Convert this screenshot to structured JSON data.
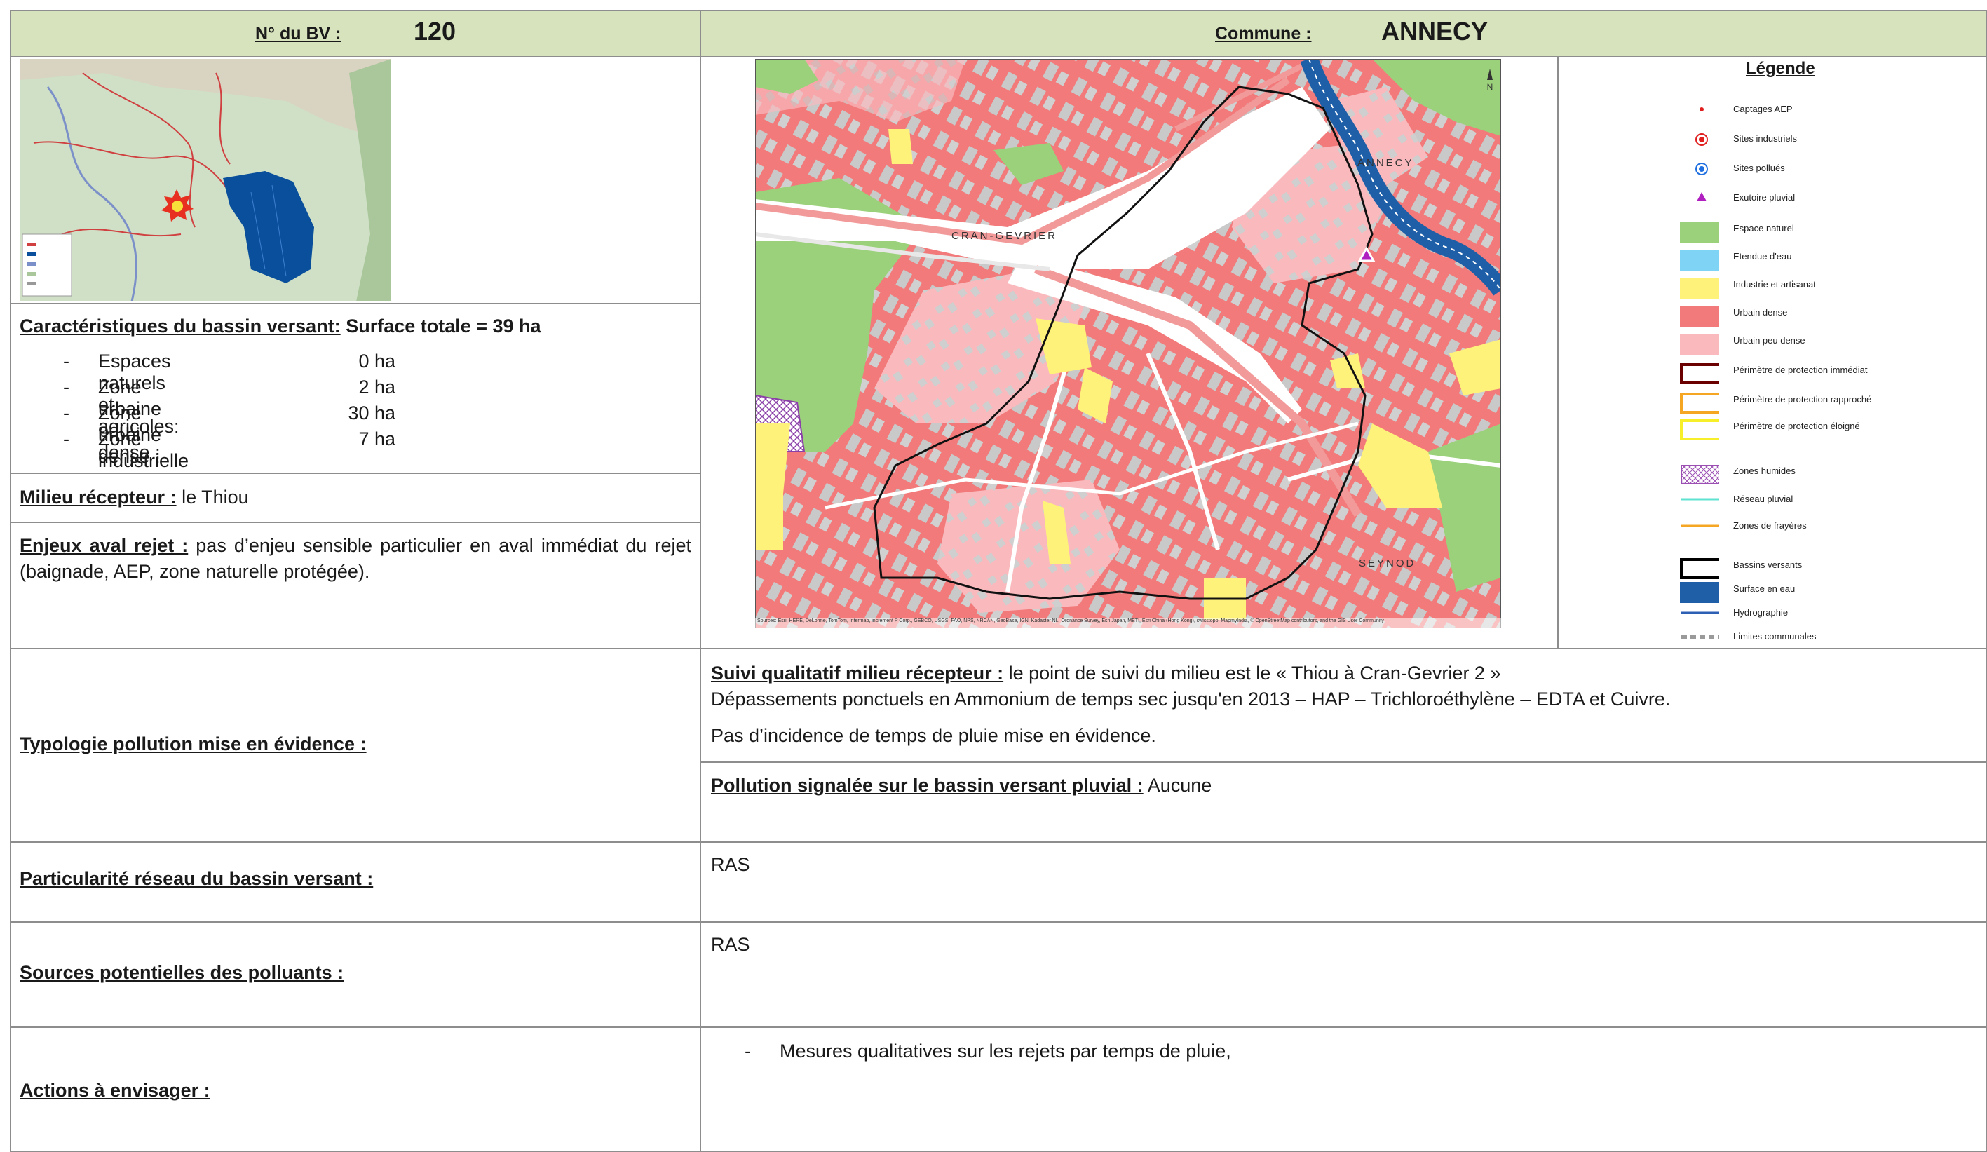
{
  "header": {
    "bv_label": "N° du BV :",
    "bv_value": "120",
    "commune_label": "Commune :",
    "commune_value": "ANNECY"
  },
  "overview_map": {
    "alt": "Carte de localisation du bassin versant"
  },
  "characteristics": {
    "title": "Caractéristiques du bassin versant:",
    "surface": "Surface totale = 39 ha",
    "items": [
      {
        "label": "Espaces naturels et agricoles:",
        "value": "0 ha"
      },
      {
        "label": "Zone urbaine peu dense :",
        "value": "2 ha"
      },
      {
        "label": "Zone urbaine dense :",
        "value": "30 ha"
      },
      {
        "label": "Zone industrielle et artisanale :",
        "value": "7 ha"
      }
    ]
  },
  "milieu": {
    "label": "Milieu récepteur :",
    "value": "le Thiou"
  },
  "enjeux": {
    "label": "Enjeux aval rejet :",
    "value": "pas d’enjeu sensible particulier en aval immédiat du rejet (baignade, AEP, zone naturelle protégée)."
  },
  "map": {
    "labels": {
      "annecy": "ANNECY",
      "cran": "CRAN-GEVRIER",
      "seynod": "SEYNOD",
      "north": "N"
    },
    "attribution": "Sources: Esri, HERE, DeLorme, TomTom, Intermap, increment P Corp., GEBCO, USGS, FAO, NPS, NRCAN, GeoBase, IGN, Kadaster NL, Ordnance Survey, Esri Japan, METI, Esri China (Hong Kong), swisstopo, MapmyIndia, © OpenStreetMap contributors, and the GIS User Community"
  },
  "legend": {
    "title": "Légende",
    "items": [
      {
        "label": "Captages AEP",
        "symbol": "dot-red"
      },
      {
        "label": "Sites industriels",
        "symbol": "ring-red"
      },
      {
        "label": "Sites pollués",
        "symbol": "ring-blue"
      },
      {
        "label": "Exutoire pluvial",
        "symbol": "triangle-purple"
      },
      {
        "label": "Espace naturel",
        "symbol": "fill",
        "color": "#9ad17a"
      },
      {
        "label": "Etendue d'eau",
        "symbol": "fill",
        "color": "#7fd3f5"
      },
      {
        "label": "Industrie et artisanat",
        "symbol": "fill",
        "color": "#fff27a"
      },
      {
        "label": "Urbain dense",
        "symbol": "fill",
        "color": "#f27a7a"
      },
      {
        "label": "Urbain peu dense",
        "symbol": "fill",
        "color": "#f9b9bd"
      },
      {
        "label": "Périmètre de protection immédiat",
        "symbol": "outline",
        "color": "#6b0000"
      },
      {
        "label": "Périmètre de protection rapproché",
        "symbol": "outline",
        "color": "#f5a623"
      },
      {
        "label": "Périmètre de protection éloigné",
        "symbol": "outline",
        "color": "#f7ef2a"
      },
      {
        "label": "Zones humides",
        "symbol": "hatch",
        "color": "#9b4fb3"
      },
      {
        "label": "Réseau pluvial",
        "symbol": "line",
        "color": "#5fe3d1"
      },
      {
        "label": "Zones de frayères",
        "symbol": "line",
        "color": "#f5a623"
      },
      {
        "label": "Bassins versants",
        "symbol": "outline",
        "color": "#000000"
      },
      {
        "label": "Surface en eau",
        "symbol": "fill",
        "color": "#1f5fa8"
      },
      {
        "label": "Hydrographie",
        "symbol": "line",
        "color": "#2d5fb5"
      },
      {
        "label": "Limites communales",
        "symbol": "dash",
        "color": "#9a9a9a"
      }
    ]
  },
  "typologie": {
    "label": "Typologie pollution mise en évidence :",
    "suivi_label": "Suivi qualitatif milieu récepteur :",
    "suivi_text": "le point de suivi du milieu est le « Thiou à Cran-Gevrier 2 »",
    "line2": "Dépassements ponctuels en Ammonium de temps sec jusqu'en 2013 – HAP – Trichloroéthylène – EDTA et Cuivre.",
    "line3": "Pas d’incidence de temps de pluie mise en évidence.",
    "pollution_label": "Pollution signalée sur le bassin versant pluvial :",
    "pollution_value": "Aucune"
  },
  "particularite": {
    "label": "Particularité réseau du bassin versant :",
    "value": "RAS"
  },
  "sources": {
    "label": "Sources potentielles des polluants :",
    "value": "RAS"
  },
  "actions": {
    "label": "Actions à envisager :",
    "items": [
      "Mesures qualitatives sur les rejets par temps de pluie,"
    ]
  }
}
